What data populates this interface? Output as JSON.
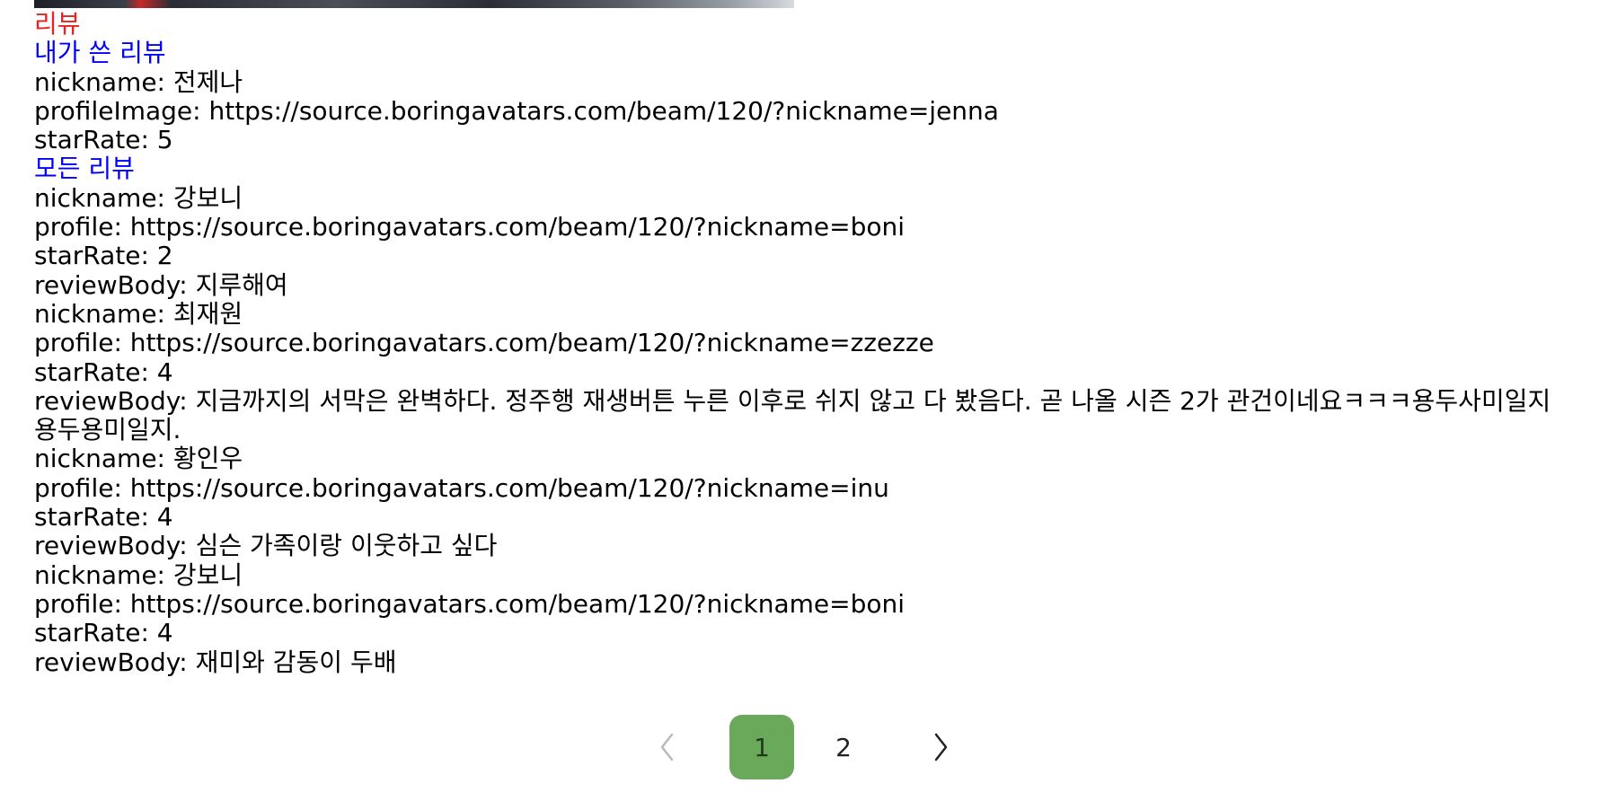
{
  "reviews": {
    "section_title": "리뷰",
    "my_review": {
      "heading": "내가 쓴 리뷰",
      "nickname_line": "nickname: 전제나",
      "profile_image_line": "profileImage: https://source.boringavatars.com/beam/120/?nickname=jenna",
      "star_rate_line": "starRate: 5"
    },
    "all_reviews": {
      "heading": "모든 리뷰",
      "items": [
        {
          "nickname_line": "nickname: 강보니",
          "profile_line": "profile: https://source.boringavatars.com/beam/120/?nickname=boni",
          "star_rate_line": "starRate: 2",
          "review_body_line": "reviewBody: 지루해여"
        },
        {
          "nickname_line": "nickname: 최재원",
          "profile_line": "profile: https://source.boringavatars.com/beam/120/?nickname=zzezze",
          "star_rate_line": "starRate: 4",
          "review_body_line": "reviewBody: 지금까지의 서막은 완벽하다. 정주행 재생버튼 누른 이후로 쉬지 않고 다 봤음다. 곧 나올 시즌 2가 관건이네요ㅋㅋㅋ용두사미일지 용두용미일지."
        },
        {
          "nickname_line": "nickname: 황인우",
          "profile_line": "profile: https://source.boringavatars.com/beam/120/?nickname=inu",
          "star_rate_line": "starRate: 4",
          "review_body_line": "reviewBody: 심슨 가족이랑 이웃하고 싶다"
        },
        {
          "nickname_line": "nickname: 강보니",
          "profile_line": "profile: https://source.boringavatars.com/beam/120/?nickname=boni",
          "star_rate_line": "starRate: 4",
          "review_body_line": "reviewBody: 재미와 감동이 두배"
        }
      ]
    }
  },
  "pagination": {
    "prev_icon": "chevron-left-icon",
    "next_icon": "chevron-right-icon",
    "pages": [
      "1",
      "2"
    ],
    "current_page": "1",
    "active_color": "#6aa85a"
  },
  "colors": {
    "section_title": "#e8231f",
    "sub_title": "#0000ff",
    "text": "#000000"
  }
}
